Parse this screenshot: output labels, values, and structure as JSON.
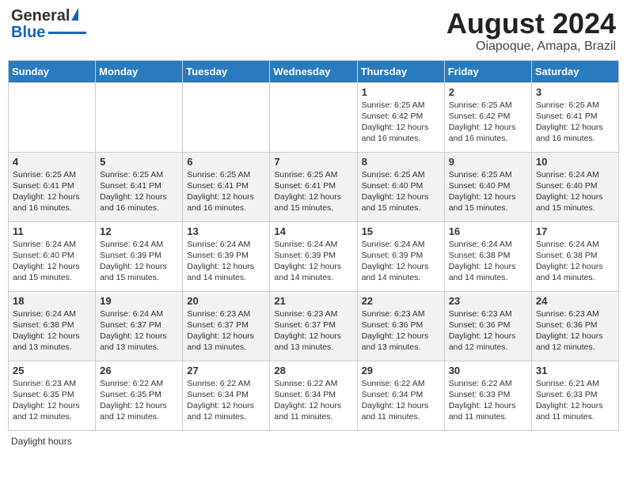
{
  "logo": {
    "line1": "General",
    "line2": "Blue",
    "triangle": "▶"
  },
  "title": "August 2024",
  "subtitle": "Oiapoque, Amapa, Brazil",
  "weekdays": [
    "Sunday",
    "Monday",
    "Tuesday",
    "Wednesday",
    "Thursday",
    "Friday",
    "Saturday"
  ],
  "footer": "Daylight hours",
  "weeks": [
    [
      {
        "day": "",
        "info": ""
      },
      {
        "day": "",
        "info": ""
      },
      {
        "day": "",
        "info": ""
      },
      {
        "day": "",
        "info": ""
      },
      {
        "day": "1",
        "info": "Sunrise: 6:25 AM\nSunset: 6:42 PM\nDaylight: 12 hours\nand 16 minutes."
      },
      {
        "day": "2",
        "info": "Sunrise: 6:25 AM\nSunset: 6:42 PM\nDaylight: 12 hours\nand 16 minutes."
      },
      {
        "day": "3",
        "info": "Sunrise: 6:25 AM\nSunset: 6:41 PM\nDaylight: 12 hours\nand 16 minutes."
      }
    ],
    [
      {
        "day": "4",
        "info": "Sunrise: 6:25 AM\nSunset: 6:41 PM\nDaylight: 12 hours\nand 16 minutes."
      },
      {
        "day": "5",
        "info": "Sunrise: 6:25 AM\nSunset: 6:41 PM\nDaylight: 12 hours\nand 16 minutes."
      },
      {
        "day": "6",
        "info": "Sunrise: 6:25 AM\nSunset: 6:41 PM\nDaylight: 12 hours\nand 16 minutes."
      },
      {
        "day": "7",
        "info": "Sunrise: 6:25 AM\nSunset: 6:41 PM\nDaylight: 12 hours\nand 15 minutes."
      },
      {
        "day": "8",
        "info": "Sunrise: 6:25 AM\nSunset: 6:40 PM\nDaylight: 12 hours\nand 15 minutes."
      },
      {
        "day": "9",
        "info": "Sunrise: 6:25 AM\nSunset: 6:40 PM\nDaylight: 12 hours\nand 15 minutes."
      },
      {
        "day": "10",
        "info": "Sunrise: 6:24 AM\nSunset: 6:40 PM\nDaylight: 12 hours\nand 15 minutes."
      }
    ],
    [
      {
        "day": "11",
        "info": "Sunrise: 6:24 AM\nSunset: 6:40 PM\nDaylight: 12 hours\nand 15 minutes."
      },
      {
        "day": "12",
        "info": "Sunrise: 6:24 AM\nSunset: 6:39 PM\nDaylight: 12 hours\nand 15 minutes."
      },
      {
        "day": "13",
        "info": "Sunrise: 6:24 AM\nSunset: 6:39 PM\nDaylight: 12 hours\nand 14 minutes."
      },
      {
        "day": "14",
        "info": "Sunrise: 6:24 AM\nSunset: 6:39 PM\nDaylight: 12 hours\nand 14 minutes."
      },
      {
        "day": "15",
        "info": "Sunrise: 6:24 AM\nSunset: 6:39 PM\nDaylight: 12 hours\nand 14 minutes."
      },
      {
        "day": "16",
        "info": "Sunrise: 6:24 AM\nSunset: 6:38 PM\nDaylight: 12 hours\nand 14 minutes."
      },
      {
        "day": "17",
        "info": "Sunrise: 6:24 AM\nSunset: 6:38 PM\nDaylight: 12 hours\nand 14 minutes."
      }
    ],
    [
      {
        "day": "18",
        "info": "Sunrise: 6:24 AM\nSunset: 6:38 PM\nDaylight: 12 hours\nand 13 minutes."
      },
      {
        "day": "19",
        "info": "Sunrise: 6:24 AM\nSunset: 6:37 PM\nDaylight: 12 hours\nand 13 minutes."
      },
      {
        "day": "20",
        "info": "Sunrise: 6:23 AM\nSunset: 6:37 PM\nDaylight: 12 hours\nand 13 minutes."
      },
      {
        "day": "21",
        "info": "Sunrise: 6:23 AM\nSunset: 6:37 PM\nDaylight: 12 hours\nand 13 minutes."
      },
      {
        "day": "22",
        "info": "Sunrise: 6:23 AM\nSunset: 6:36 PM\nDaylight: 12 hours\nand 13 minutes."
      },
      {
        "day": "23",
        "info": "Sunrise: 6:23 AM\nSunset: 6:36 PM\nDaylight: 12 hours\nand 12 minutes."
      },
      {
        "day": "24",
        "info": "Sunrise: 6:23 AM\nSunset: 6:36 PM\nDaylight: 12 hours\nand 12 minutes."
      }
    ],
    [
      {
        "day": "25",
        "info": "Sunrise: 6:23 AM\nSunset: 6:35 PM\nDaylight: 12 hours\nand 12 minutes."
      },
      {
        "day": "26",
        "info": "Sunrise: 6:22 AM\nSunset: 6:35 PM\nDaylight: 12 hours\nand 12 minutes."
      },
      {
        "day": "27",
        "info": "Sunrise: 6:22 AM\nSunset: 6:34 PM\nDaylight: 12 hours\nand 12 minutes."
      },
      {
        "day": "28",
        "info": "Sunrise: 6:22 AM\nSunset: 6:34 PM\nDaylight: 12 hours\nand 11 minutes."
      },
      {
        "day": "29",
        "info": "Sunrise: 6:22 AM\nSunset: 6:34 PM\nDaylight: 12 hours\nand 11 minutes."
      },
      {
        "day": "30",
        "info": "Sunrise: 6:22 AM\nSunset: 6:33 PM\nDaylight: 12 hours\nand 11 minutes."
      },
      {
        "day": "31",
        "info": "Sunrise: 6:21 AM\nSunset: 6:33 PM\nDaylight: 12 hours\nand 11 minutes."
      }
    ]
  ]
}
